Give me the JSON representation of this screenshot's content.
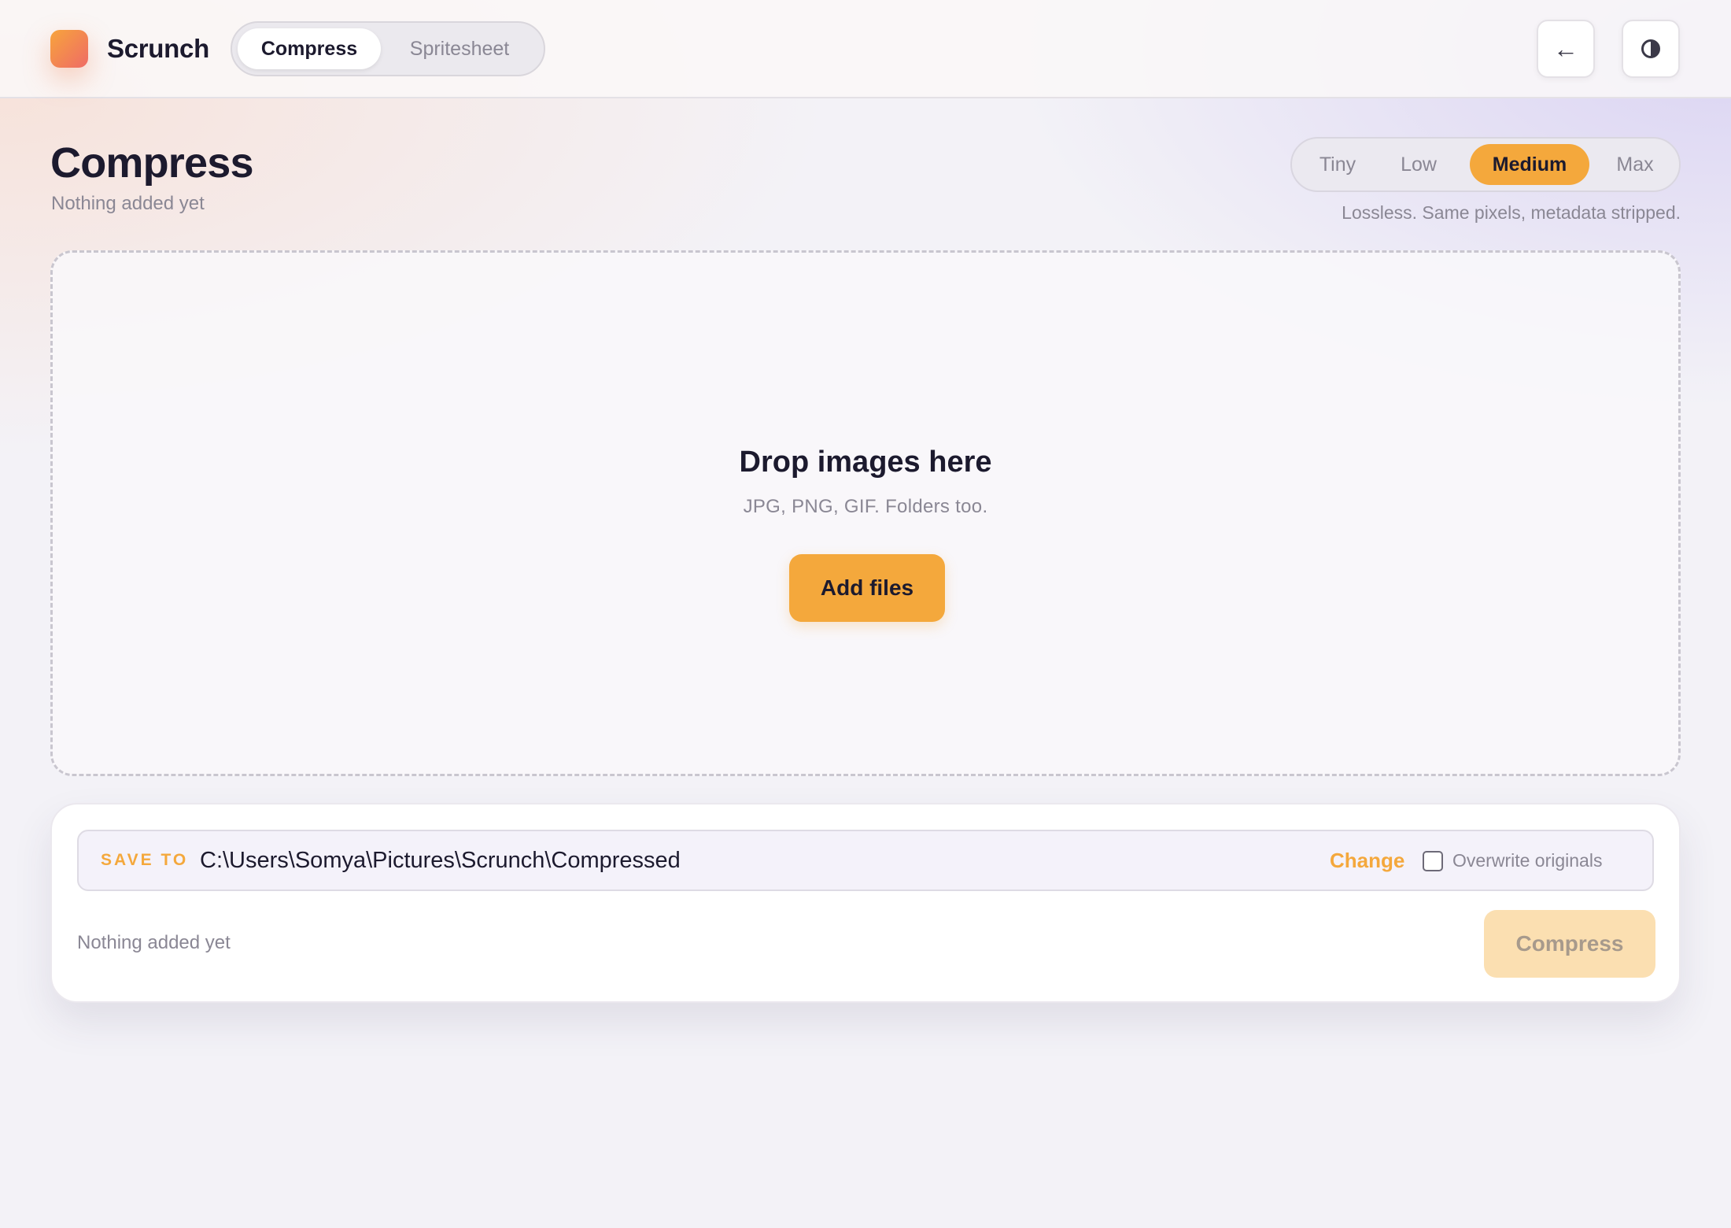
{
  "app": {
    "name": "Scrunch",
    "logo_icon": "app-logo-gradient-square",
    "accent_color": "#f4a83c"
  },
  "header": {
    "tabs": [
      {
        "label": "Compress",
        "active": true
      },
      {
        "label": "Spritesheet",
        "active": false
      }
    ],
    "back_icon": "←",
    "theme_icon": "contrast-icon"
  },
  "page": {
    "title": "Compress",
    "subtitle": "Nothing added yet"
  },
  "quality": {
    "options": [
      "Tiny",
      "Low",
      "Medium",
      "Max"
    ],
    "selected": "Medium",
    "hint": "Lossless. Same pixels, metadata stripped."
  },
  "dropzone": {
    "title": "Drop images here",
    "hint": "JPG, PNG, GIF. Folders too.",
    "button_label": "Add files"
  },
  "output": {
    "save_label": "SAVE TO",
    "path": "C:\\Users\\Somya\\Pictures\\Scrunch\\Compressed",
    "change_label": "Change",
    "overwrite_label": "Overwrite originals",
    "overwrite_checked": false
  },
  "footer": {
    "status": "Nothing added yet",
    "compress_label": "Compress",
    "compress_enabled": false
  }
}
